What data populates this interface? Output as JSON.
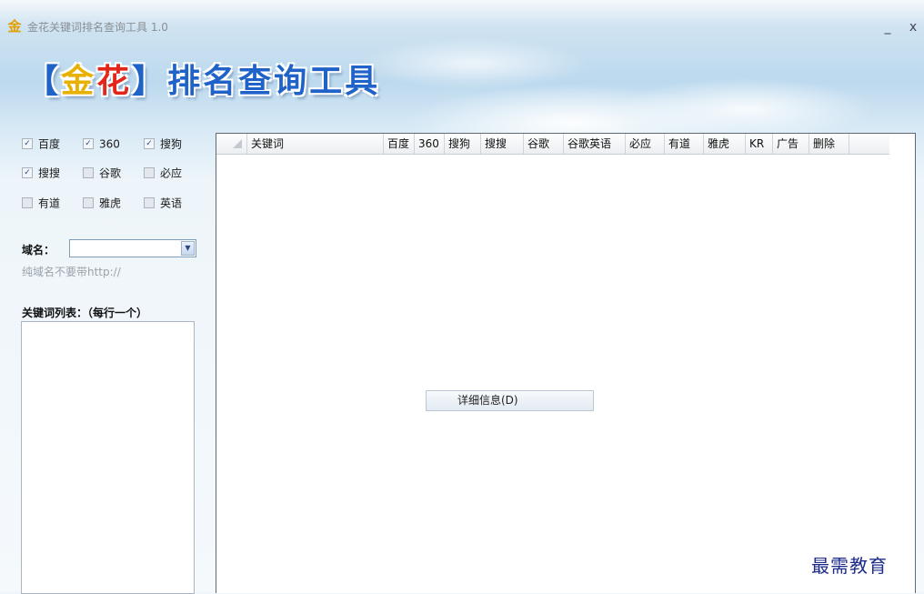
{
  "window": {
    "icon": "金",
    "title": "金花关键词排名查询工具 1.0",
    "minimize": "_",
    "close": "x"
  },
  "brand": {
    "open_bracket": "【",
    "gold": "金",
    "red": "花",
    "close_bracket": "】",
    "rest": "排名查询工具"
  },
  "engines": [
    {
      "label": "百度",
      "checked": true
    },
    {
      "label": "360",
      "checked": true
    },
    {
      "label": "搜狗",
      "checked": true
    },
    {
      "label": "搜搜",
      "checked": true
    },
    {
      "label": "谷歌",
      "checked": false
    },
    {
      "label": "必应",
      "checked": false
    },
    {
      "label": "有道",
      "checked": false
    },
    {
      "label": "雅虎",
      "checked": false
    },
    {
      "label": "英语",
      "checked": false
    }
  ],
  "domain": {
    "label": "域名：",
    "value": "",
    "hint": "纯域名不要带http://"
  },
  "keywords": {
    "label": "关键词列表：（每行一个）",
    "value": ""
  },
  "table": {
    "columns": [
      "关键词",
      "百度",
      "360",
      "搜狗",
      "搜搜",
      "谷歌",
      "谷歌英语",
      "必应",
      "有道",
      "雅虎",
      "KR",
      "广告",
      "删除"
    ],
    "rows": []
  },
  "context_menu": {
    "item": "详细信息(D)"
  },
  "watermark": "最需教育",
  "colors": {
    "brand_blue": "#1f63c9",
    "brand_red": "#e3261b",
    "brand_gold": "#e8b000"
  }
}
